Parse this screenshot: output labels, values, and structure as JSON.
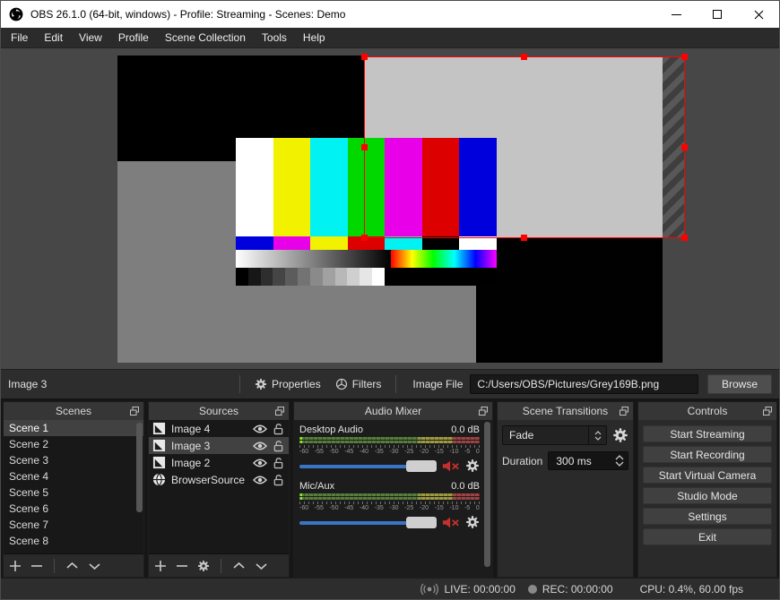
{
  "window": {
    "title": "OBS 26.1.0 (64-bit, windows) - Profile: Streaming - Scenes: Demo",
    "buttons": [
      "minimize",
      "maximize",
      "close"
    ]
  },
  "menu": {
    "items": [
      "File",
      "Edit",
      "View",
      "Profile",
      "Scene Collection",
      "Tools",
      "Help"
    ]
  },
  "toolbar": {
    "selected_source": "Image 3",
    "properties_label": "Properties",
    "filters_label": "Filters",
    "image_file_label": "Image File",
    "image_file_path": "C:/Users/OBS/Pictures/Grey169B.png",
    "browse_label": "Browse"
  },
  "docks": {
    "scenes": {
      "title": "Scenes",
      "items": [
        "Scene 1",
        "Scene 2",
        "Scene 3",
        "Scene 4",
        "Scene 5",
        "Scene 6",
        "Scene 7",
        "Scene 8"
      ],
      "selected": "Scene 1"
    },
    "sources": {
      "title": "Sources",
      "items": [
        {
          "name": "Image 4",
          "icon": "image-icon"
        },
        {
          "name": "Image 3",
          "icon": "image-icon"
        },
        {
          "name": "Image 2",
          "icon": "image-icon"
        },
        {
          "name": "BrowserSource",
          "icon": "globe-icon"
        }
      ],
      "selected": "Image 3"
    },
    "mixer": {
      "title": "Audio Mixer",
      "channels": [
        {
          "name": "Desktop Audio",
          "level_db": "0.0 dB",
          "muted": true
        },
        {
          "name": "Mic/Aux",
          "level_db": "0.0 dB",
          "muted": true
        }
      ],
      "ticks": [
        "-60",
        "-55",
        "-50",
        "-45",
        "-40",
        "-35",
        "-30",
        "-25",
        "-20",
        "-15",
        "-10",
        "-5",
        "0"
      ]
    },
    "transitions": {
      "title": "Scene Transitions",
      "transition": "Fade",
      "duration_label": "Duration",
      "duration_value": "300 ms"
    },
    "controls": {
      "title": "Controls",
      "buttons": [
        "Start Streaming",
        "Start Recording",
        "Start Virtual Camera",
        "Studio Mode",
        "Settings",
        "Exit"
      ]
    }
  },
  "statusbar": {
    "live": "LIVE: 00:00:00",
    "rec": "REC: 00:00:00",
    "cpu": "CPU: 0.4%, 60.00 fps"
  },
  "colors": {
    "selection_red": "#ff0000",
    "meter_green": "#577d3d",
    "meter_yellow": "#9d9b40",
    "meter_red": "#9c4343",
    "slider_blue": "#3a75c4",
    "canvas_gray": "#7e7e7e",
    "canvas_lightgray": "#c4c4c4",
    "preview_bg": "#474747"
  }
}
